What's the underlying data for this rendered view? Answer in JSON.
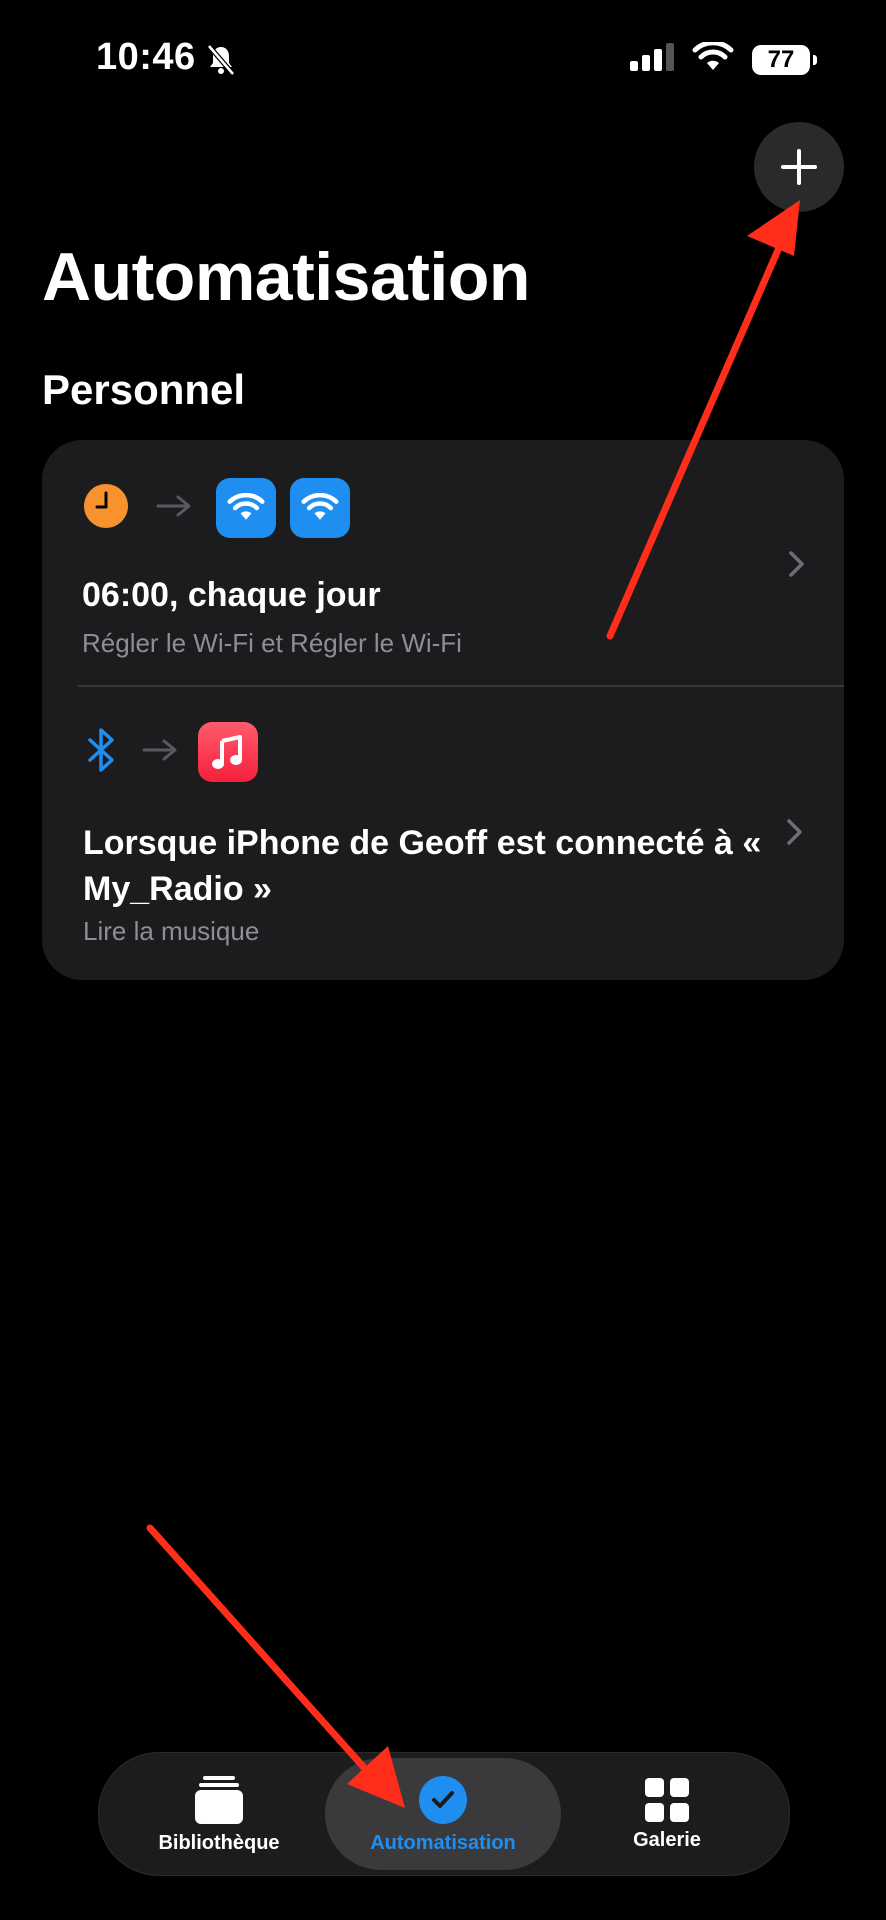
{
  "status_bar": {
    "time": "10:46",
    "battery": "77"
  },
  "page": {
    "title": "Automatisation",
    "section": "Personnel"
  },
  "automations": [
    {
      "title": "06:00, chaque jour",
      "subtitle": "Régler le Wi-Fi et Régler le Wi-Fi",
      "trigger_icon": "clock-icon",
      "action_icons": [
        "wifi-icon",
        "wifi-icon"
      ]
    },
    {
      "title": "Lorsque iPhone de Geoff est connecté à « My_Radio »",
      "subtitle": "Lire la musique",
      "trigger_icon": "bluetooth-icon",
      "action_icons": [
        "music-icon"
      ]
    }
  ],
  "tabs": [
    {
      "label": "Bibliothèque",
      "icon": "library-icon"
    },
    {
      "label": "Automatisation",
      "icon": "automation-icon",
      "active": true
    },
    {
      "label": "Galerie",
      "icon": "gallery-icon"
    }
  ],
  "colors": {
    "accent": "#1f8ef1",
    "arrow": "#ff2d1a",
    "clock": "#f7922e",
    "card": "#1c1c1e"
  }
}
